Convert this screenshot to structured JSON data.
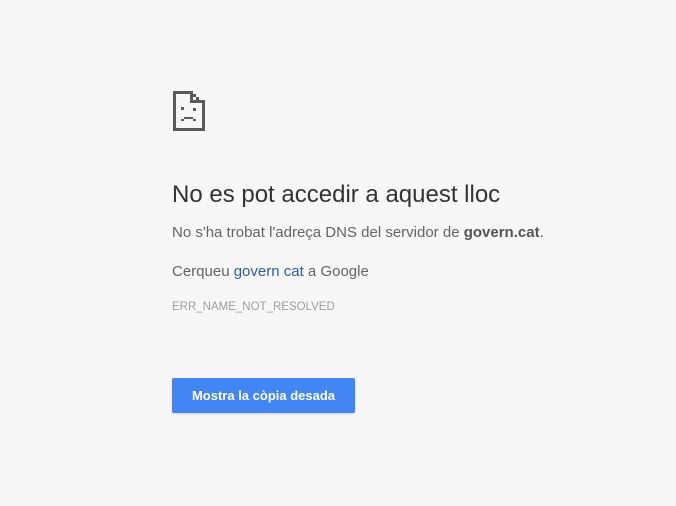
{
  "icon": "sad-page-icon",
  "title": "No es pot accedir a aquest lloc",
  "summary": {
    "prefix": "No s'ha trobat l'adreça DNS del servidor de ",
    "host": "govern.cat",
    "suffix": "."
  },
  "suggestion": {
    "prefix": "Cerqueu ",
    "link": "govern cat",
    "suffix": " a Google"
  },
  "error_code": "ERR_NAME_NOT_RESOLVED",
  "button": {
    "label": "Mostra la còpia desada"
  },
  "colors": {
    "background": "#f7f7f7",
    "button": "#4285f4",
    "link": "#2a5db0"
  }
}
